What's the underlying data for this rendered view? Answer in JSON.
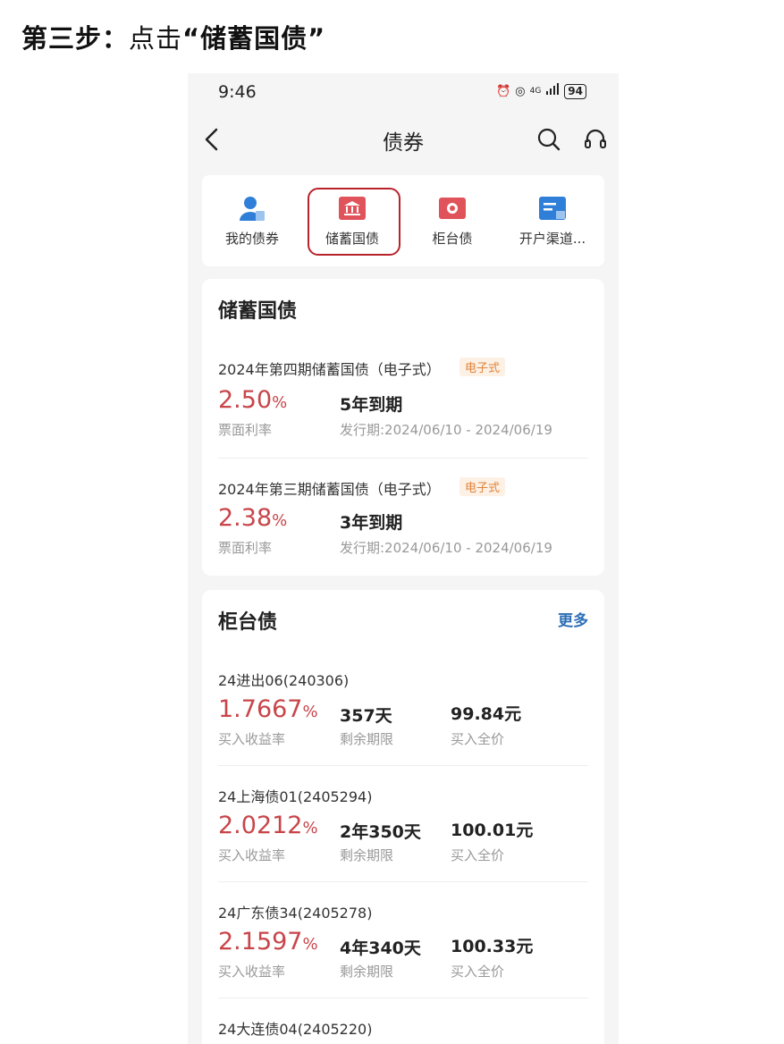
{
  "instruction": {
    "prefix": "第三步：",
    "action": "点击",
    "target": "“储蓄国债”"
  },
  "status_bar": {
    "time": "9:46",
    "network": "4G",
    "battery": "94"
  },
  "nav": {
    "title": "债券"
  },
  "menu": [
    {
      "label": "我的债券",
      "icon": "person-icon",
      "color": "#2f7fd8"
    },
    {
      "label": "储蓄国债",
      "icon": "bank-icon",
      "color": "#e0535a"
    },
    {
      "label": "柜台债",
      "icon": "ticket-icon",
      "color": "#e0535a"
    },
    {
      "label": "开户渠道...",
      "icon": "card-icon",
      "color": "#2f7fd8"
    }
  ],
  "savings": {
    "title": "储蓄国债",
    "items": [
      {
        "name": "2024年第四期储蓄国债（电子式）",
        "tag": "电子式",
        "rate": "2.50",
        "rate_unit": "%",
        "rate_label": "票面利率",
        "term": "5年到期",
        "period": "发行期:2024/06/10 - 2024/06/19"
      },
      {
        "name": "2024年第三期储蓄国债（电子式）",
        "tag": "电子式",
        "rate": "2.38",
        "rate_unit": "%",
        "rate_label": "票面利率",
        "term": "3年到期",
        "period": "发行期:2024/06/10 - 2024/06/19"
      }
    ]
  },
  "counter": {
    "title": "柜台债",
    "more": "更多",
    "items": [
      {
        "name": "24进出06(240306)",
        "rate": "1.7667",
        "rate_unit": "%",
        "rate_label": "买入收益率",
        "term": "357天",
        "term_label": "剩余期限",
        "price": "99.84元",
        "price_label": "买入全价"
      },
      {
        "name": "24上海债01(2405294)",
        "rate": "2.0212",
        "rate_unit": "%",
        "rate_label": "买入收益率",
        "term": "2年350天",
        "term_label": "剩余期限",
        "price": "100.01元",
        "price_label": "买入全价"
      },
      {
        "name": "24广东债34(2405278)",
        "rate": "2.1597",
        "rate_unit": "%",
        "rate_label": "买入收益率",
        "term": "4年340天",
        "term_label": "剩余期限",
        "price": "100.33元",
        "price_label": "买入全价"
      },
      {
        "name": "24大连债04(2405220)"
      }
    ]
  }
}
